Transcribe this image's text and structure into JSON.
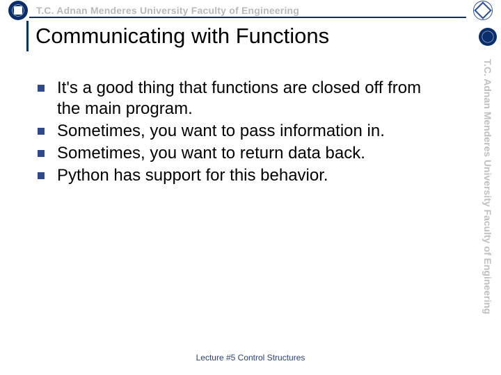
{
  "header": {
    "institution_line": "T.C.    Adnan Menderes University    Faculty of Engineering"
  },
  "title": "Communicating with Functions",
  "bullets": [
    "It's a good thing that functions are closed off from the main program.",
    "Sometimes, you want to pass information in.",
    "Sometimes, you want to return data back.",
    "Python has support for this behavior."
  ],
  "footer": "Lecture #5 Control Structures",
  "side_text": "T.C.    Adnan Menderes University    Faculty of Engineering"
}
